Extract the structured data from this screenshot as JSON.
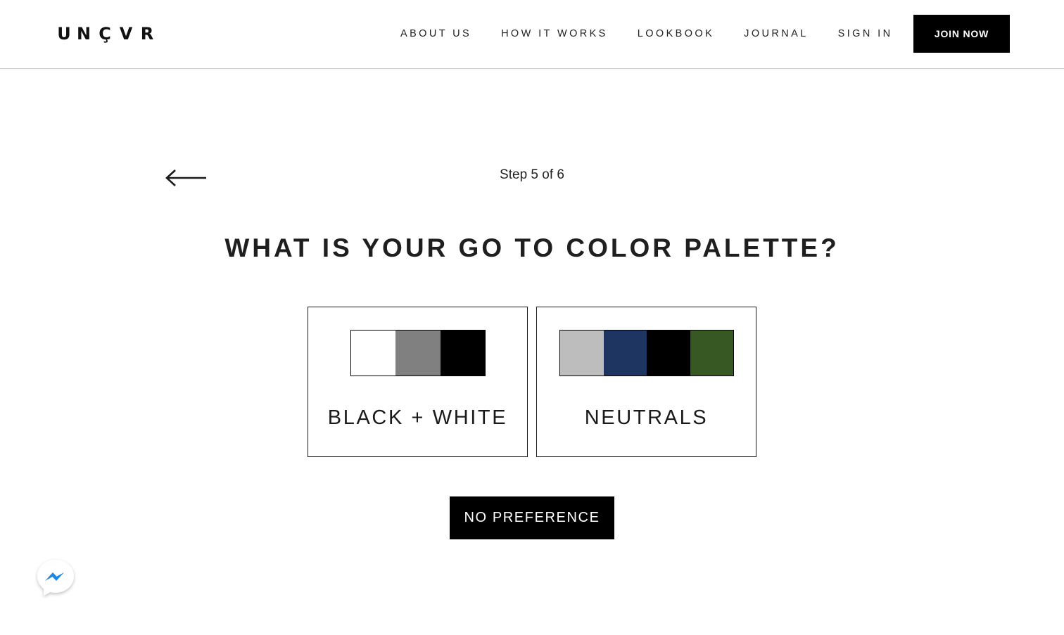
{
  "header": {
    "logo_letters": [
      "U",
      "N",
      "Ç",
      "V",
      "R"
    ],
    "nav": [
      {
        "label": "ABOUT US"
      },
      {
        "label": "HOW IT WORKS"
      },
      {
        "label": "LOOKBOOK"
      },
      {
        "label": "JOURNAL"
      },
      {
        "label": "SIGN IN"
      }
    ],
    "join_label": "JOIN NOW"
  },
  "quiz": {
    "back_icon": "arrow-left-icon",
    "step_text": "Step 5 of 6",
    "question": "WHAT IS YOUR GO TO COLOR PALETTE?",
    "options": [
      {
        "label": "BLACK + WHITE",
        "colors": [
          "#ffffff",
          "#808080",
          "#000000"
        ]
      },
      {
        "label": "NEUTRALS",
        "colors": [
          "#bdbdbd",
          "#1e3562",
          "#000000",
          "#375823"
        ]
      }
    ],
    "no_preference_label": "NO PREFERENCE"
  },
  "chat": {
    "icon": "messenger-icon",
    "bubble_color": "#ffffff",
    "bolt_color": "#1e88e5"
  }
}
